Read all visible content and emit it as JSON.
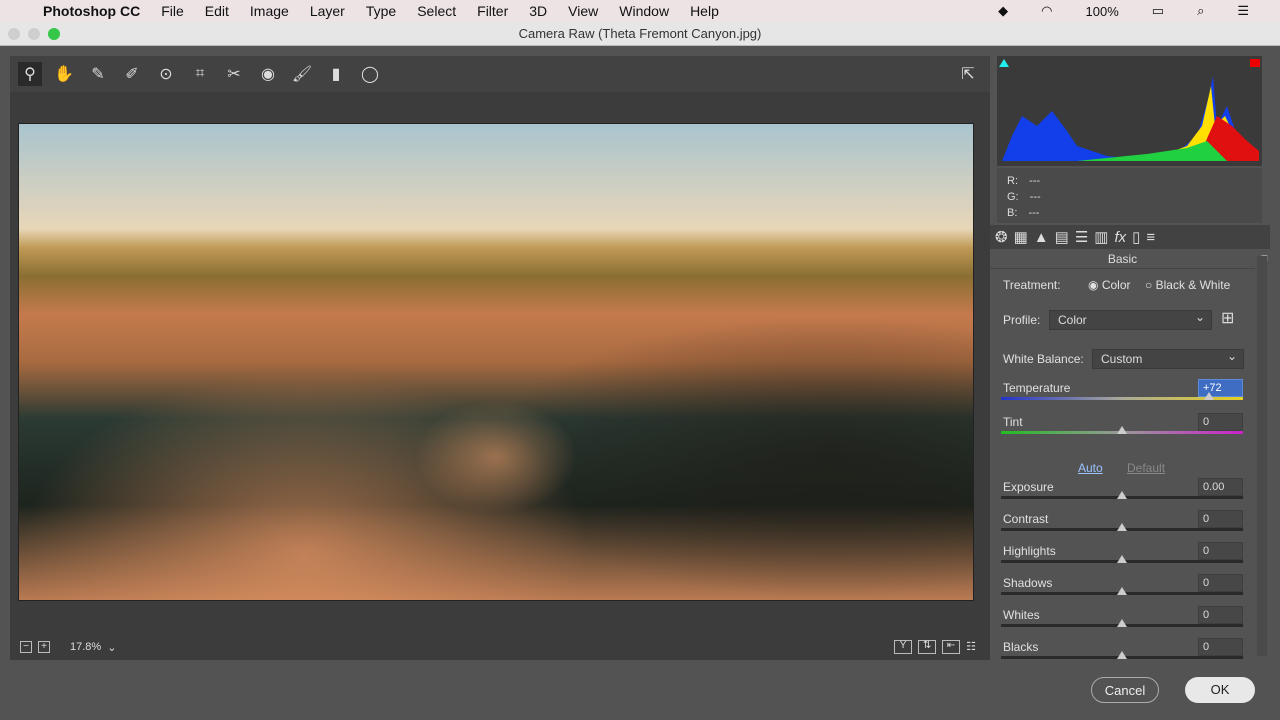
{
  "menubar": {
    "app": "Photoshop CC",
    "items": [
      "File",
      "Edit",
      "Image",
      "Layer",
      "Type",
      "Select",
      "Filter",
      "3D",
      "View",
      "Window",
      "Help"
    ],
    "battery": "100%"
  },
  "window": {
    "title": "Camera Raw (Theta Fremont Canyon.jpg)"
  },
  "toolbar": {
    "tools": [
      "zoom-icon",
      "hand-icon",
      "white-balance-icon",
      "color-sampler-icon",
      "targeted-adjustment-icon",
      "transform-icon",
      "spot-removal-icon",
      "red-eye-icon",
      "adjustment-brush-icon",
      "graduated-filter-icon",
      "radial-filter-icon"
    ]
  },
  "preview": {
    "zoom": "17.8%"
  },
  "readout": {
    "r_label": "R:",
    "g_label": "G:",
    "b_label": "B:",
    "r": "---",
    "g": "---",
    "b": "---"
  },
  "panel": {
    "title": "Basic",
    "treatment_label": "Treatment:",
    "treatment_options": [
      "Color",
      "Black & White"
    ],
    "treatment_selected": "Color",
    "profile_label": "Profile:",
    "profile": "Color",
    "wb_label": "White Balance:",
    "wb": "Custom",
    "auto": "Auto",
    "default": "Default",
    "sliders": [
      {
        "label": "Temperature",
        "value": "+72",
        "pos": 0.86,
        "track": "temp"
      },
      {
        "label": "Tint",
        "value": "0",
        "pos": 0.5,
        "track": "tint"
      },
      {
        "label": "Exposure",
        "value": "0.00",
        "pos": 0.5
      },
      {
        "label": "Contrast",
        "value": "0",
        "pos": 0.5
      },
      {
        "label": "Highlights",
        "value": "0",
        "pos": 0.5
      },
      {
        "label": "Shadows",
        "value": "0",
        "pos": 0.5
      },
      {
        "label": "Whites",
        "value": "0",
        "pos": 0.5
      },
      {
        "label": "Blacks",
        "value": "0",
        "pos": 0.5
      }
    ]
  },
  "buttons": {
    "cancel": "Cancel",
    "ok": "OK"
  }
}
